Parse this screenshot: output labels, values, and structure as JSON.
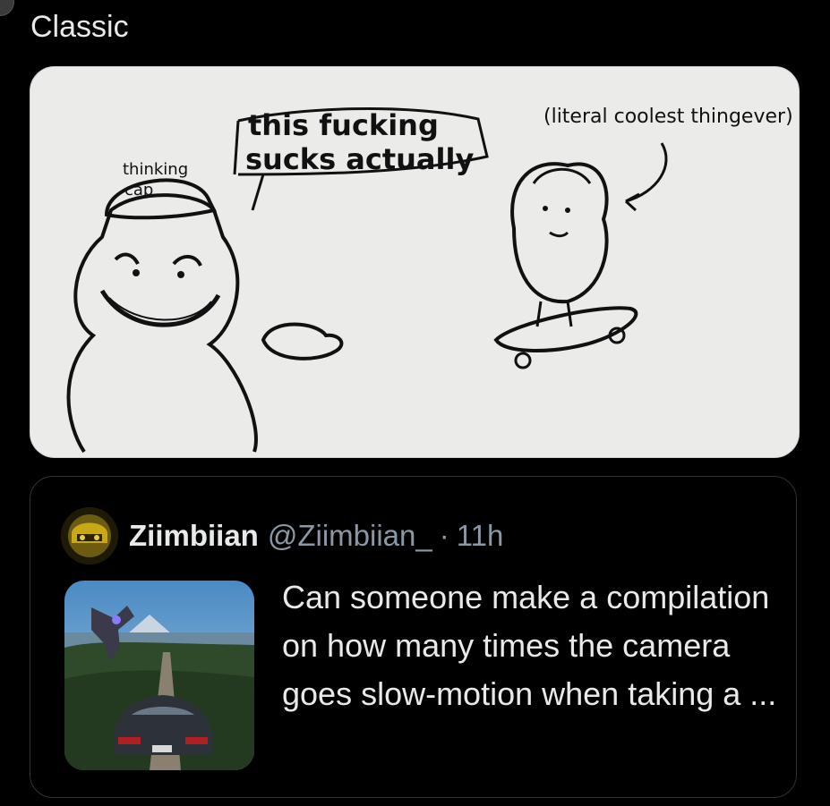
{
  "tweet": {
    "text": "Classic"
  },
  "comic": {
    "speech_bubble_line1": "this fucking",
    "speech_bubble_line2": "sucks actually",
    "caption": "(literal coolest thingever)",
    "hat_label_line1": "thinking",
    "hat_label_line2": "cap"
  },
  "quote": {
    "name": "Ziimbiian",
    "handle": "@Ziimbiian_",
    "separator": "·",
    "time": "11h",
    "text": "Can someone make a compilation on how many times the camera goes slow-motion when taking a ..."
  }
}
